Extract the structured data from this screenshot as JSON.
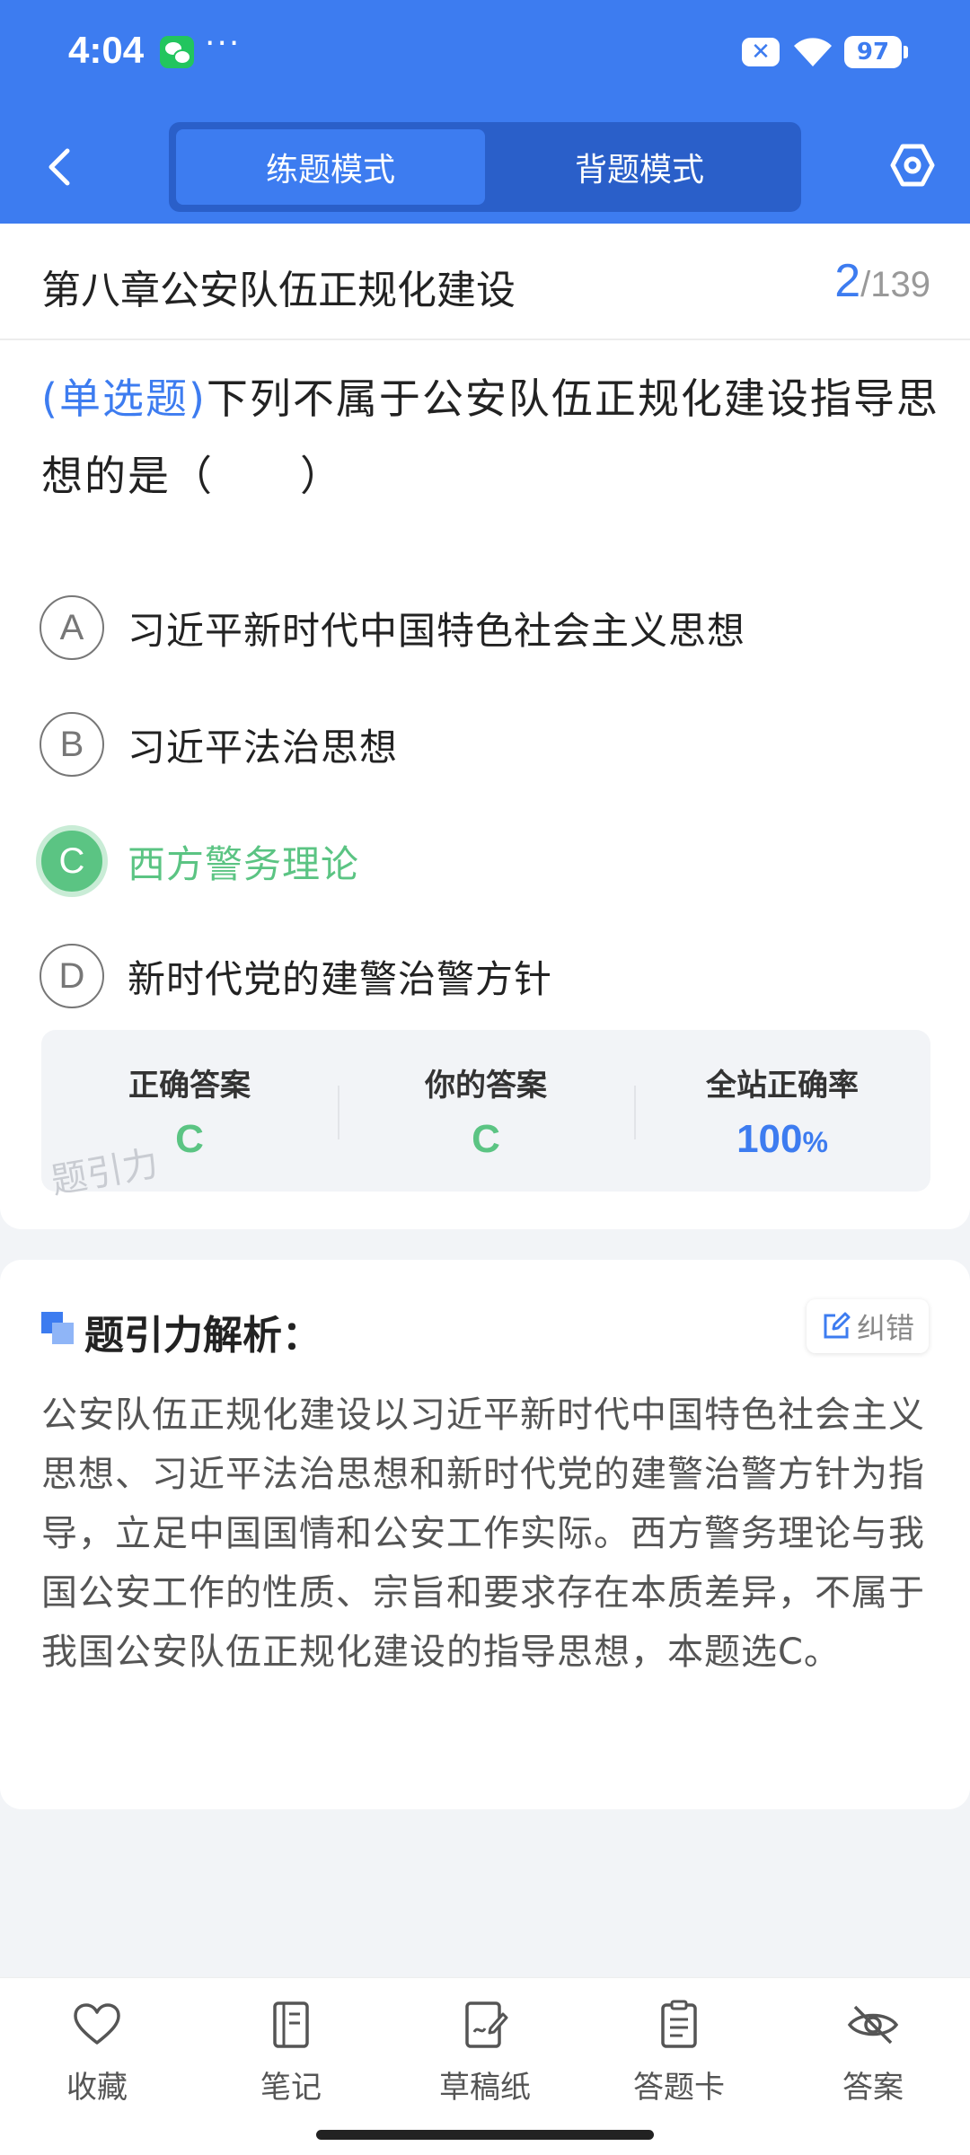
{
  "status_bar": {
    "time": "4:04",
    "more": "···",
    "battery": "97"
  },
  "header": {
    "tabs": [
      {
        "label": "练题模式",
        "active": true
      },
      {
        "label": "背题模式",
        "active": false
      }
    ]
  },
  "chapter": {
    "title": "第八章公安队伍正规化建设",
    "current": "2",
    "total": "/139"
  },
  "question": {
    "type": "(单选题)",
    "text": "下列不属于公安队伍正规化建设指导思想的是（　　）",
    "options": [
      {
        "letter": "A",
        "text": "习近平新时代中国特色社会主义思想"
      },
      {
        "letter": "B",
        "text": "习近平法治思想"
      },
      {
        "letter": "C",
        "text": "西方警务理论",
        "correct": true
      },
      {
        "letter": "D",
        "text": "新时代党的建警治警方针"
      }
    ]
  },
  "answer": {
    "correct_label": "正确答案",
    "correct_value": "C",
    "yours_label": "你的答案",
    "yours_value": "C",
    "rate_label": "全站正确率",
    "rate_value": "100",
    "rate_unit": "%",
    "watermark": "题引力"
  },
  "analysis": {
    "title": "题引力解析：",
    "report_label": "纠错",
    "text": "公安队伍正规化建设以习近平新时代中国特色社会主义思想、习近平法治思想和新时代党的建警治警方针为指导，立足中国国情和公安工作实际。西方警务理论与我国公安工作的性质、宗旨和要求存在本质差异，不属于我国公安队伍正规化建设的指导思想，本题选C。"
  },
  "bottom_bar": {
    "items": [
      {
        "label": "收藏",
        "icon": "heart-icon"
      },
      {
        "label": "笔记",
        "icon": "notebook-icon"
      },
      {
        "label": "草稿纸",
        "icon": "draft-paper-icon"
      },
      {
        "label": "答题卡",
        "icon": "answer-sheet-icon"
      },
      {
        "label": "答案",
        "icon": "eye-off-icon"
      }
    ]
  },
  "colors": {
    "primary": "#3d7cf0",
    "correct": "#5bc483",
    "background": "#f2f4f7"
  }
}
